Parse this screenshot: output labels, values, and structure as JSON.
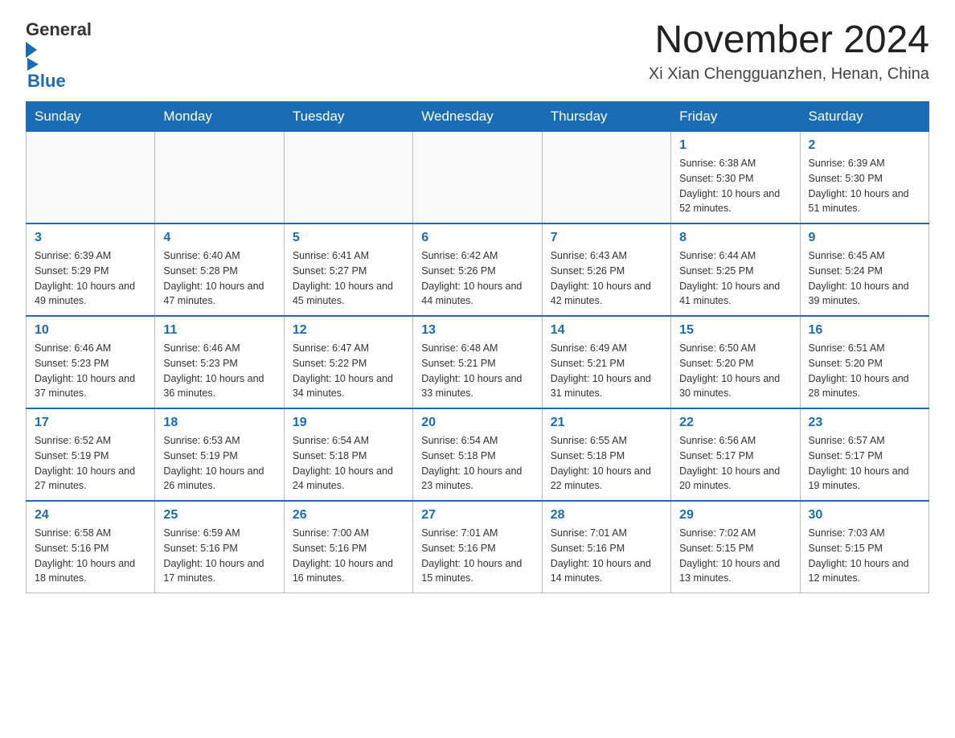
{
  "logo": {
    "general": "General",
    "blue": "Blue"
  },
  "title": "November 2024",
  "location": "Xi Xian Chengguanzhen, Henan, China",
  "days_of_week": [
    "Sunday",
    "Monday",
    "Tuesday",
    "Wednesday",
    "Thursday",
    "Friday",
    "Saturday"
  ],
  "weeks": [
    [
      {
        "day": "",
        "info": ""
      },
      {
        "day": "",
        "info": ""
      },
      {
        "day": "",
        "info": ""
      },
      {
        "day": "",
        "info": ""
      },
      {
        "day": "",
        "info": ""
      },
      {
        "day": "1",
        "info": "Sunrise: 6:38 AM\nSunset: 5:30 PM\nDaylight: 10 hours and 52 minutes."
      },
      {
        "day": "2",
        "info": "Sunrise: 6:39 AM\nSunset: 5:30 PM\nDaylight: 10 hours and 51 minutes."
      }
    ],
    [
      {
        "day": "3",
        "info": "Sunrise: 6:39 AM\nSunset: 5:29 PM\nDaylight: 10 hours and 49 minutes."
      },
      {
        "day": "4",
        "info": "Sunrise: 6:40 AM\nSunset: 5:28 PM\nDaylight: 10 hours and 47 minutes."
      },
      {
        "day": "5",
        "info": "Sunrise: 6:41 AM\nSunset: 5:27 PM\nDaylight: 10 hours and 45 minutes."
      },
      {
        "day": "6",
        "info": "Sunrise: 6:42 AM\nSunset: 5:26 PM\nDaylight: 10 hours and 44 minutes."
      },
      {
        "day": "7",
        "info": "Sunrise: 6:43 AM\nSunset: 5:26 PM\nDaylight: 10 hours and 42 minutes."
      },
      {
        "day": "8",
        "info": "Sunrise: 6:44 AM\nSunset: 5:25 PM\nDaylight: 10 hours and 41 minutes."
      },
      {
        "day": "9",
        "info": "Sunrise: 6:45 AM\nSunset: 5:24 PM\nDaylight: 10 hours and 39 minutes."
      }
    ],
    [
      {
        "day": "10",
        "info": "Sunrise: 6:46 AM\nSunset: 5:23 PM\nDaylight: 10 hours and 37 minutes."
      },
      {
        "day": "11",
        "info": "Sunrise: 6:46 AM\nSunset: 5:23 PM\nDaylight: 10 hours and 36 minutes."
      },
      {
        "day": "12",
        "info": "Sunrise: 6:47 AM\nSunset: 5:22 PM\nDaylight: 10 hours and 34 minutes."
      },
      {
        "day": "13",
        "info": "Sunrise: 6:48 AM\nSunset: 5:21 PM\nDaylight: 10 hours and 33 minutes."
      },
      {
        "day": "14",
        "info": "Sunrise: 6:49 AM\nSunset: 5:21 PM\nDaylight: 10 hours and 31 minutes."
      },
      {
        "day": "15",
        "info": "Sunrise: 6:50 AM\nSunset: 5:20 PM\nDaylight: 10 hours and 30 minutes."
      },
      {
        "day": "16",
        "info": "Sunrise: 6:51 AM\nSunset: 5:20 PM\nDaylight: 10 hours and 28 minutes."
      }
    ],
    [
      {
        "day": "17",
        "info": "Sunrise: 6:52 AM\nSunset: 5:19 PM\nDaylight: 10 hours and 27 minutes."
      },
      {
        "day": "18",
        "info": "Sunrise: 6:53 AM\nSunset: 5:19 PM\nDaylight: 10 hours and 26 minutes."
      },
      {
        "day": "19",
        "info": "Sunrise: 6:54 AM\nSunset: 5:18 PM\nDaylight: 10 hours and 24 minutes."
      },
      {
        "day": "20",
        "info": "Sunrise: 6:54 AM\nSunset: 5:18 PM\nDaylight: 10 hours and 23 minutes."
      },
      {
        "day": "21",
        "info": "Sunrise: 6:55 AM\nSunset: 5:18 PM\nDaylight: 10 hours and 22 minutes."
      },
      {
        "day": "22",
        "info": "Sunrise: 6:56 AM\nSunset: 5:17 PM\nDaylight: 10 hours and 20 minutes."
      },
      {
        "day": "23",
        "info": "Sunrise: 6:57 AM\nSunset: 5:17 PM\nDaylight: 10 hours and 19 minutes."
      }
    ],
    [
      {
        "day": "24",
        "info": "Sunrise: 6:58 AM\nSunset: 5:16 PM\nDaylight: 10 hours and 18 minutes."
      },
      {
        "day": "25",
        "info": "Sunrise: 6:59 AM\nSunset: 5:16 PM\nDaylight: 10 hours and 17 minutes."
      },
      {
        "day": "26",
        "info": "Sunrise: 7:00 AM\nSunset: 5:16 PM\nDaylight: 10 hours and 16 minutes."
      },
      {
        "day": "27",
        "info": "Sunrise: 7:01 AM\nSunset: 5:16 PM\nDaylight: 10 hours and 15 minutes."
      },
      {
        "day": "28",
        "info": "Sunrise: 7:01 AM\nSunset: 5:16 PM\nDaylight: 10 hours and 14 minutes."
      },
      {
        "day": "29",
        "info": "Sunrise: 7:02 AM\nSunset: 5:15 PM\nDaylight: 10 hours and 13 minutes."
      },
      {
        "day": "30",
        "info": "Sunrise: 7:03 AM\nSunset: 5:15 PM\nDaylight: 10 hours and 12 minutes."
      }
    ]
  ]
}
